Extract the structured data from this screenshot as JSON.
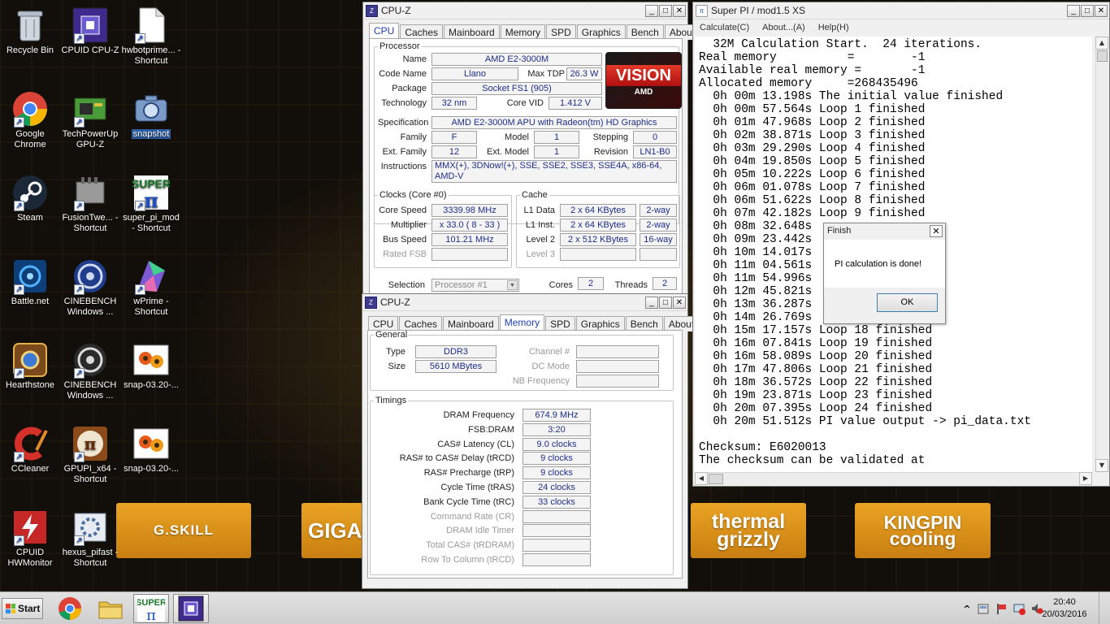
{
  "desktop": {
    "icons": [
      {
        "label": "Recycle Bin",
        "icon": "recycle-bin-icon"
      },
      {
        "label": "CPUID CPU-Z",
        "icon": "cpuz-icon"
      },
      {
        "label": "hwbotprime... - Shortcut",
        "icon": "file-shortcut-icon"
      },
      {
        "label": "Google Chrome",
        "icon": "chrome-icon"
      },
      {
        "label": "TechPowerUp GPU-Z",
        "icon": "gpuz-icon"
      },
      {
        "label": "snapshot",
        "icon": "camera-icon"
      },
      {
        "label": "Steam",
        "icon": "steam-icon"
      },
      {
        "label": "FusionTwe... - Shortcut",
        "icon": "fusion-icon"
      },
      {
        "label": "super_pi_mod - Shortcut",
        "icon": "superpi-icon"
      },
      {
        "label": "Battle.net",
        "icon": "battlenet-icon"
      },
      {
        "label": "CINEBENCH Windows ...",
        "icon": "cinebench-icon"
      },
      {
        "label": "wPrime - Shortcut",
        "icon": "wprime-icon"
      },
      {
        "label": "Hearthstone",
        "icon": "hearthstone-icon"
      },
      {
        "label": "CINEBENCH Windows ...",
        "icon": "cinebench-icon"
      },
      {
        "label": "snap-03.20-...",
        "icon": "image-file-icon"
      },
      {
        "label": "CCleaner",
        "icon": "ccleaner-icon"
      },
      {
        "label": "GPUPI_x64 - Shortcut",
        "icon": "gpupi-icon"
      },
      {
        "label": "snap-03.20-...",
        "icon": "image-file-icon"
      },
      {
        "label": "CPUID HWMonitor",
        "icon": "hwmonitor-icon"
      },
      {
        "label": "hexus_pifast - Shortcut",
        "icon": "pifast-icon"
      }
    ],
    "sponsors": [
      "G.SKILL",
      "GIGA",
      "thermal grizzly",
      "KINGPIN cooling"
    ]
  },
  "cpuz_cpu": {
    "title": "CPU-Z",
    "tabs": [
      "CPU",
      "Caches",
      "Mainboard",
      "Memory",
      "SPD",
      "Graphics",
      "Bench",
      "About"
    ],
    "active_tab": "CPU",
    "processor_legend": "Processor",
    "name_label": "Name",
    "name": "AMD E2-3000M",
    "codename_label": "Code Name",
    "codename": "Llano",
    "maxtdp_label": "Max TDP",
    "maxtdp": "26.3 W",
    "package_label": "Package",
    "package": "Socket FS1 (905)",
    "technology_label": "Technology",
    "technology": "32 nm",
    "corevid_label": "Core VID",
    "corevid": "1.412 V",
    "spec_label": "Specification",
    "spec": "AMD E2-3000M APU with Radeon(tm) HD Graphics",
    "family_label": "Family",
    "family": "F",
    "model_label": "Model",
    "model": "1",
    "stepping_label": "Stepping",
    "stepping": "0",
    "extfamily_label": "Ext. Family",
    "extfamily": "12",
    "extmodel_label": "Ext. Model",
    "extmodel": "1",
    "revision_label": "Revision",
    "revision": "LN1-B0",
    "instructions_label": "Instructions",
    "instructions": "MMX(+), 3DNow!(+), SSE, SSE2, SSE3, SSE4A, x86-64, AMD-V",
    "logo_text": "VISION",
    "logo_sub": "AMD",
    "clocks_legend": "Clocks (Core #0)",
    "corespeed_label": "Core Speed",
    "corespeed": "3339.98 MHz",
    "multiplier_label": "Multiplier",
    "multiplier": "x 33.0 ( 8 - 33 )",
    "busspeed_label": "Bus Speed",
    "busspeed": "101.21 MHz",
    "ratedfsb_label": "Rated FSB",
    "cache_legend": "Cache",
    "l1d_label": "L1 Data",
    "l1d": "2 x 64 KBytes",
    "l1d_way": "2-way",
    "l1i_label": "L1 Inst.",
    "l1i": "2 x 64 KBytes",
    "l1i_way": "2-way",
    "l2_label": "Level 2",
    "l2": "2 x 512 KBytes",
    "l2_way": "16-way",
    "l3_label": "Level 3",
    "selection_label": "Selection",
    "selection": "Processor #1",
    "cores_label": "Cores",
    "cores": "2",
    "threads_label": "Threads",
    "threads": "2"
  },
  "cpuz_mem": {
    "title": "CPU-Z",
    "tabs": [
      "CPU",
      "Caches",
      "Mainboard",
      "Memory",
      "SPD",
      "Graphics",
      "Bench",
      "About"
    ],
    "active_tab": "Memory",
    "general_legend": "General",
    "type_label": "Type",
    "type": "DDR3",
    "size_label": "Size",
    "size": "5610 MBytes",
    "channel_label": "Channel #",
    "dcmode_label": "DC Mode",
    "nbfreq_label": "NB Frequency",
    "timings_legend": "Timings",
    "timings": [
      {
        "label": "DRAM Frequency",
        "value": "674.9 MHz",
        "enabled": true
      },
      {
        "label": "FSB:DRAM",
        "value": "3:20",
        "enabled": true
      },
      {
        "label": "CAS# Latency (CL)",
        "value": "9.0 clocks",
        "enabled": true
      },
      {
        "label": "RAS# to CAS# Delay (tRCD)",
        "value": "9 clocks",
        "enabled": true
      },
      {
        "label": "RAS# Precharge (tRP)",
        "value": "9 clocks",
        "enabled": true
      },
      {
        "label": "Cycle Time (tRAS)",
        "value": "24 clocks",
        "enabled": true
      },
      {
        "label": "Bank Cycle Time (tRC)",
        "value": "33 clocks",
        "enabled": true
      },
      {
        "label": "Command Rate (CR)",
        "value": "",
        "enabled": false
      },
      {
        "label": "DRAM Idle Timer",
        "value": "",
        "enabled": false
      },
      {
        "label": "Total CAS# (tRDRAM)",
        "value": "",
        "enabled": false
      },
      {
        "label": "Row To Column (tRCD)",
        "value": "",
        "enabled": false
      }
    ]
  },
  "superpi": {
    "title": "Super PI / mod1.5 XS",
    "menu": [
      "Calculate(C)",
      "About...(A)",
      "Help(H)"
    ],
    "lines": [
      "  32M Calculation Start.  24 iterations.",
      "Real memory          =        -1",
      "Available real memory =       -1",
      "Allocated memory     =268435496",
      "  0h 00m 13.198s The initial value finished",
      "  0h 00m 57.564s Loop 1 finished",
      "  0h 01m 47.968s Loop 2 finished",
      "  0h 02m 38.871s Loop 3 finished",
      "  0h 03m 29.290s Loop 4 finished",
      "  0h 04m 19.850s Loop 5 finished",
      "  0h 05m 10.222s Loop 6 finished",
      "  0h 06m 01.078s Loop 7 finished",
      "  0h 06m 51.622s Loop 8 finished",
      "  0h 07m 42.182s Loop 9 finished",
      "  0h 08m 32.648s",
      "  0h 09m 23.442s",
      "  0h 10m 14.017s",
      "  0h 11m 04.561s",
      "  0h 11m 54.996s",
      "  0h 12m 45.821s",
      "  0h 13m 36.287s",
      "  0h 14m 26.769s",
      "  0h 15m 17.157s Loop 18 finished",
      "  0h 16m 07.841s Loop 19 finished",
      "  0h 16m 58.089s Loop 20 finished",
      "  0h 17m 47.806s Loop 21 finished",
      "  0h 18m 36.572s Loop 22 finished",
      "  0h 19m 23.871s Loop 23 finished",
      "  0h 20m 07.395s Loop 24 finished",
      "  0h 20m 51.512s PI value output -> pi_data.txt",
      "",
      "Checksum: E6020013",
      "The checksum can be validated at"
    ]
  },
  "dialog": {
    "title": "Finish",
    "message": "PI calculation is done!",
    "ok": "OK",
    "close": "✕"
  },
  "taskbar": {
    "start": "Start",
    "time": "20:40",
    "date": "20/03/2016",
    "tray_expand": "^"
  },
  "colors": {
    "tab_active": "#1c3fb5",
    "value_text": "#1e2d8c",
    "sponsor_orange": "#e9a324"
  }
}
